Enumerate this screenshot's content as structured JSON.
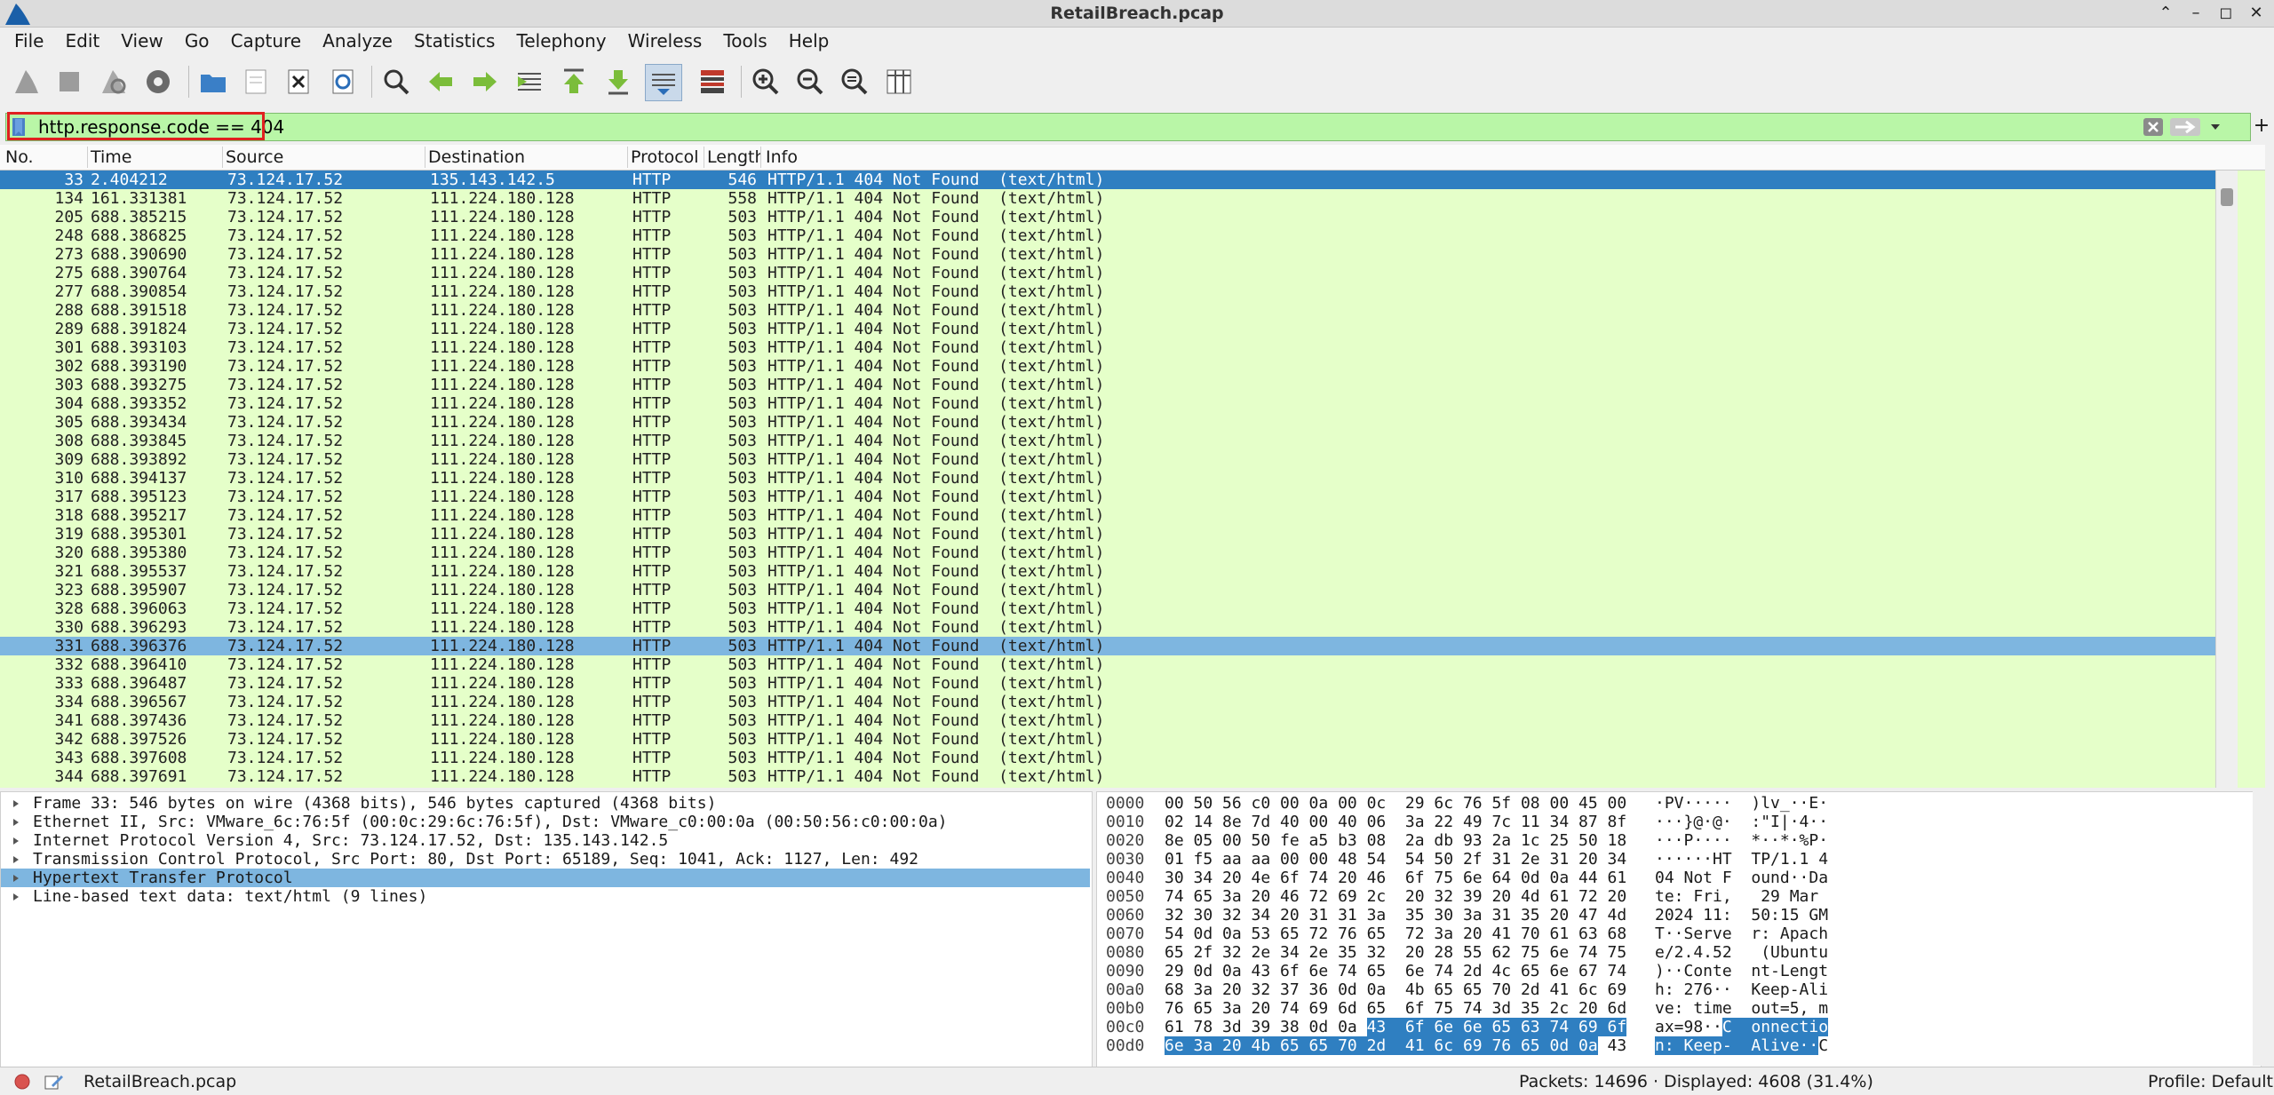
{
  "window": {
    "title": "RetailBreach.pcap",
    "controls": [
      "⌃",
      "–",
      "◻",
      "✕"
    ]
  },
  "menu": [
    "File",
    "Edit",
    "View",
    "Go",
    "Capture",
    "Analyze",
    "Statistics",
    "Telephony",
    "Wireless",
    "Tools",
    "Help"
  ],
  "toolbar_icons": [
    "shark-fin-start-icon",
    "stop-icon",
    "restart-icon",
    "gear-options-icon",
    "open-folder-icon",
    "save-file-icon",
    "close-file-icon",
    "reload-icon",
    "search-icon",
    "go-back-icon",
    "go-forward-icon",
    "go-to-packet-icon",
    "first-packet-icon",
    "last-packet-icon",
    "auto-scroll-icon",
    "colorize-icon",
    "zoom-in-icon",
    "zoom-out-icon",
    "zoom-reset-icon",
    "resize-columns-icon"
  ],
  "filter": {
    "value": "http.response.code == 404",
    "plus": "+"
  },
  "columns": [
    "No.",
    "Time",
    "Source",
    "Destination",
    "Protocol",
    "Length",
    "Info"
  ],
  "packets": [
    {
      "no": "33",
      "time": "2.404212",
      "src": "73.124.17.52",
      "dst": "135.143.142.5",
      "proto": "HTTP",
      "len": "546",
      "info": "HTTP/1.1 404 Not Found  (text/html)",
      "state": "selected"
    },
    {
      "no": "134",
      "time": "161.331381",
      "src": "73.124.17.52",
      "dst": "111.224.180.128",
      "proto": "HTTP",
      "len": "558",
      "info": "HTTP/1.1 404 Not Found  (text/html)"
    },
    {
      "no": "205",
      "time": "688.385215",
      "src": "73.124.17.52",
      "dst": "111.224.180.128",
      "proto": "HTTP",
      "len": "503",
      "info": "HTTP/1.1 404 Not Found  (text/html)"
    },
    {
      "no": "248",
      "time": "688.386825",
      "src": "73.124.17.52",
      "dst": "111.224.180.128",
      "proto": "HTTP",
      "len": "503",
      "info": "HTTP/1.1 404 Not Found  (text/html)"
    },
    {
      "no": "273",
      "time": "688.390690",
      "src": "73.124.17.52",
      "dst": "111.224.180.128",
      "proto": "HTTP",
      "len": "503",
      "info": "HTTP/1.1 404 Not Found  (text/html)"
    },
    {
      "no": "275",
      "time": "688.390764",
      "src": "73.124.17.52",
      "dst": "111.224.180.128",
      "proto": "HTTP",
      "len": "503",
      "info": "HTTP/1.1 404 Not Found  (text/html)"
    },
    {
      "no": "277",
      "time": "688.390854",
      "src": "73.124.17.52",
      "dst": "111.224.180.128",
      "proto": "HTTP",
      "len": "503",
      "info": "HTTP/1.1 404 Not Found  (text/html)"
    },
    {
      "no": "288",
      "time": "688.391518",
      "src": "73.124.17.52",
      "dst": "111.224.180.128",
      "proto": "HTTP",
      "len": "503",
      "info": "HTTP/1.1 404 Not Found  (text/html)"
    },
    {
      "no": "289",
      "time": "688.391824",
      "src": "73.124.17.52",
      "dst": "111.224.180.128",
      "proto": "HTTP",
      "len": "503",
      "info": "HTTP/1.1 404 Not Found  (text/html)"
    },
    {
      "no": "301",
      "time": "688.393103",
      "src": "73.124.17.52",
      "dst": "111.224.180.128",
      "proto": "HTTP",
      "len": "503",
      "info": "HTTP/1.1 404 Not Found  (text/html)"
    },
    {
      "no": "302",
      "time": "688.393190",
      "src": "73.124.17.52",
      "dst": "111.224.180.128",
      "proto": "HTTP",
      "len": "503",
      "info": "HTTP/1.1 404 Not Found  (text/html)"
    },
    {
      "no": "303",
      "time": "688.393275",
      "src": "73.124.17.52",
      "dst": "111.224.180.128",
      "proto": "HTTP",
      "len": "503",
      "info": "HTTP/1.1 404 Not Found  (text/html)"
    },
    {
      "no": "304",
      "time": "688.393352",
      "src": "73.124.17.52",
      "dst": "111.224.180.128",
      "proto": "HTTP",
      "len": "503",
      "info": "HTTP/1.1 404 Not Found  (text/html)"
    },
    {
      "no": "305",
      "time": "688.393434",
      "src": "73.124.17.52",
      "dst": "111.224.180.128",
      "proto": "HTTP",
      "len": "503",
      "info": "HTTP/1.1 404 Not Found  (text/html)"
    },
    {
      "no": "308",
      "time": "688.393845",
      "src": "73.124.17.52",
      "dst": "111.224.180.128",
      "proto": "HTTP",
      "len": "503",
      "info": "HTTP/1.1 404 Not Found  (text/html)"
    },
    {
      "no": "309",
      "time": "688.393892",
      "src": "73.124.17.52",
      "dst": "111.224.180.128",
      "proto": "HTTP",
      "len": "503",
      "info": "HTTP/1.1 404 Not Found  (text/html)"
    },
    {
      "no": "310",
      "time": "688.394137",
      "src": "73.124.17.52",
      "dst": "111.224.180.128",
      "proto": "HTTP",
      "len": "503",
      "info": "HTTP/1.1 404 Not Found  (text/html)"
    },
    {
      "no": "317",
      "time": "688.395123",
      "src": "73.124.17.52",
      "dst": "111.224.180.128",
      "proto": "HTTP",
      "len": "503",
      "info": "HTTP/1.1 404 Not Found  (text/html)"
    },
    {
      "no": "318",
      "time": "688.395217",
      "src": "73.124.17.52",
      "dst": "111.224.180.128",
      "proto": "HTTP",
      "len": "503",
      "info": "HTTP/1.1 404 Not Found  (text/html)"
    },
    {
      "no": "319",
      "time": "688.395301",
      "src": "73.124.17.52",
      "dst": "111.224.180.128",
      "proto": "HTTP",
      "len": "503",
      "info": "HTTP/1.1 404 Not Found  (text/html)"
    },
    {
      "no": "320",
      "time": "688.395380",
      "src": "73.124.17.52",
      "dst": "111.224.180.128",
      "proto": "HTTP",
      "len": "503",
      "info": "HTTP/1.1 404 Not Found  (text/html)"
    },
    {
      "no": "321",
      "time": "688.395537",
      "src": "73.124.17.52",
      "dst": "111.224.180.128",
      "proto": "HTTP",
      "len": "503",
      "info": "HTTP/1.1 404 Not Found  (text/html)"
    },
    {
      "no": "323",
      "time": "688.395907",
      "src": "73.124.17.52",
      "dst": "111.224.180.128",
      "proto": "HTTP",
      "len": "503",
      "info": "HTTP/1.1 404 Not Found  (text/html)"
    },
    {
      "no": "328",
      "time": "688.396063",
      "src": "73.124.17.52",
      "dst": "111.224.180.128",
      "proto": "HTTP",
      "len": "503",
      "info": "HTTP/1.1 404 Not Found  (text/html)"
    },
    {
      "no": "330",
      "time": "688.396293",
      "src": "73.124.17.52",
      "dst": "111.224.180.128",
      "proto": "HTTP",
      "len": "503",
      "info": "HTTP/1.1 404 Not Found  (text/html)"
    },
    {
      "no": "331",
      "time": "688.396376",
      "src": "73.124.17.52",
      "dst": "111.224.180.128",
      "proto": "HTTP",
      "len": "503",
      "info": "HTTP/1.1 404 Not Found  (text/html)",
      "state": "highlight"
    },
    {
      "no": "332",
      "time": "688.396410",
      "src": "73.124.17.52",
      "dst": "111.224.180.128",
      "proto": "HTTP",
      "len": "503",
      "info": "HTTP/1.1 404 Not Found  (text/html)"
    },
    {
      "no": "333",
      "time": "688.396487",
      "src": "73.124.17.52",
      "dst": "111.224.180.128",
      "proto": "HTTP",
      "len": "503",
      "info": "HTTP/1.1 404 Not Found  (text/html)"
    },
    {
      "no": "334",
      "time": "688.396567",
      "src": "73.124.17.52",
      "dst": "111.224.180.128",
      "proto": "HTTP",
      "len": "503",
      "info": "HTTP/1.1 404 Not Found  (text/html)"
    },
    {
      "no": "341",
      "time": "688.397436",
      "src": "73.124.17.52",
      "dst": "111.224.180.128",
      "proto": "HTTP",
      "len": "503",
      "info": "HTTP/1.1 404 Not Found  (text/html)"
    },
    {
      "no": "342",
      "time": "688.397526",
      "src": "73.124.17.52",
      "dst": "111.224.180.128",
      "proto": "HTTP",
      "len": "503",
      "info": "HTTP/1.1 404 Not Found  (text/html)"
    },
    {
      "no": "343",
      "time": "688.397608",
      "src": "73.124.17.52",
      "dst": "111.224.180.128",
      "proto": "HTTP",
      "len": "503",
      "info": "HTTP/1.1 404 Not Found  (text/html)"
    },
    {
      "no": "344",
      "time": "688.397691",
      "src": "73.124.17.52",
      "dst": "111.224.180.128",
      "proto": "HTTP",
      "len": "503",
      "info": "HTTP/1.1 404 Not Found  (text/html)"
    }
  ],
  "details": [
    {
      "text": "Frame 33: 546 bytes on wire (4368 bits), 546 bytes captured (4368 bits)"
    },
    {
      "text": "Ethernet II, Src: VMware_6c:76:5f (00:0c:29:6c:76:5f), Dst: VMware_c0:00:0a (00:50:56:c0:00:0a)"
    },
    {
      "text": "Internet Protocol Version 4, Src: 73.124.17.52, Dst: 135.143.142.5"
    },
    {
      "text": "Transmission Control Protocol, Src Port: 80, Dst Port: 65189, Seq: 1041, Ack: 1127, Len: 492"
    },
    {
      "text": "Hypertext Transfer Protocol",
      "selected": true
    },
    {
      "text": "Line-based text data: text/html (9 lines)"
    }
  ],
  "bytes": [
    {
      "off": "0000",
      "hex": "00 50 56 c0 00 0a 00 0c  29 6c 76 5f 08 00 45 00",
      "ascii": "·PV·····  )lv_··E·"
    },
    {
      "off": "0010",
      "hex": "02 14 8e 7d 40 00 40 06  3a 22 49 7c 11 34 87 8f",
      "ascii": "···}@·@·  :\"I|·4··"
    },
    {
      "off": "0020",
      "hex": "8e 05 00 50 fe a5 b3 08  2a db 93 2a 1c 25 50 18",
      "ascii": "···P····  *··*·%P·"
    },
    {
      "off": "0030",
      "hex": "01 f5 aa aa 00 00 48 54  54 50 2f 31 2e 31 20 34",
      "ascii": "······HT  TP/1.1 4"
    },
    {
      "off": "0040",
      "hex": "30 34 20 4e 6f 74 20 46  6f 75 6e 64 0d 0a 44 61",
      "ascii": "04 Not F  ound··Da"
    },
    {
      "off": "0050",
      "hex": "74 65 3a 20 46 72 69 2c  20 32 39 20 4d 61 72 20",
      "ascii": "te: Fri,   29 Mar "
    },
    {
      "off": "0060",
      "hex": "32 30 32 34 20 31 31 3a  35 30 3a 31 35 20 47 4d",
      "ascii": "2024 11:  50:15 GM"
    },
    {
      "off": "0070",
      "hex": "54 0d 0a 53 65 72 76 65  72 3a 20 41 70 61 63 68",
      "ascii": "T··Serve  r: Apach"
    },
    {
      "off": "0080",
      "hex": "65 2f 32 2e 34 2e 35 32  20 28 55 62 75 6e 74 75",
      "ascii": "e/2.4.52   (Ubuntu"
    },
    {
      "off": "0090",
      "hex": "29 0d 0a 43 6f 6e 74 65  6e 74 2d 4c 65 6e 67 74",
      "ascii": ")··Conte  nt-Lengt"
    },
    {
      "off": "00a0",
      "hex": "68 3a 20 32 37 36 0d 0a  4b 65 65 70 2d 41 6c 69",
      "ascii": "h: 276··  Keep-Ali"
    },
    {
      "off": "00b0",
      "hex": "76 65 3a 20 74 69 6d 65  6f 75 74 3d 35 2c 20 6d",
      "ascii": "ve: time  out=5, m"
    },
    {
      "off": "00c0",
      "hex_plain": "61 78 3d 39 38 0d 0a ",
      "hex_sel": "43  6f 6e 6e 65 63 74 69 6f",
      "ascii_plain": "ax=98··",
      "ascii_sel": "C  onnectio"
    },
    {
      "off": "00d0",
      "hex_sel": "6e 3a 20 4b 65 65 70 2d  41 6c 69 76 65 0d 0a",
      "hex_plain": " 43",
      "ascii_sel": "n: Keep-  Alive··",
      "ascii_plain": "C"
    }
  ],
  "status": {
    "file": "RetailBreach.pcap",
    "packets": "Packets: 14696 · Displayed: 4608 (31.4%)",
    "profile": "Profile: Default"
  },
  "colors": {
    "row_bg": "#e5ffc9",
    "selected": "#2f7fc1",
    "highlight": "#7eb6e0",
    "filter_bg": "#b9f6a7",
    "filter_outline": "#e02020"
  }
}
